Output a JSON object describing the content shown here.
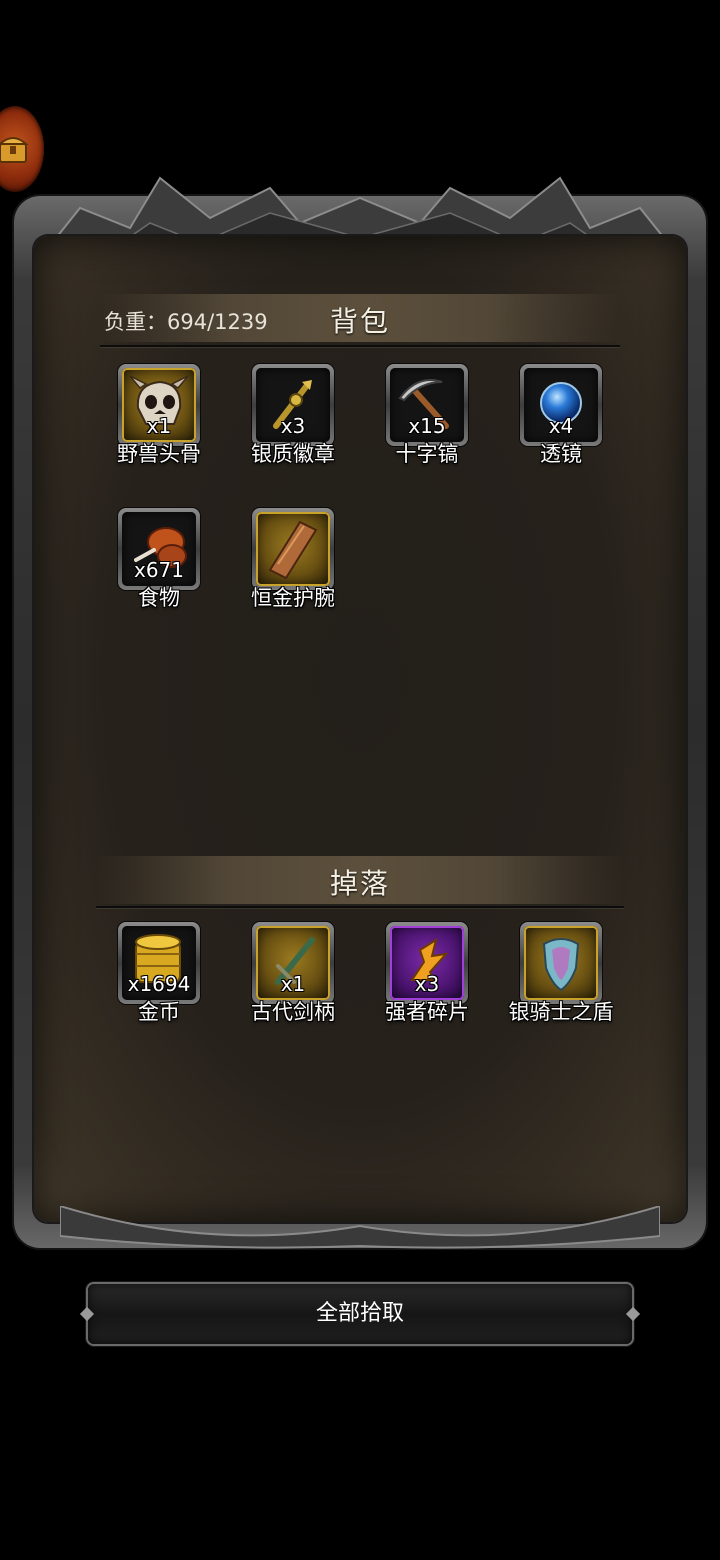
{
  "colors": {
    "gold_frame": "#c9a22a",
    "purple_frame": "#a040d8",
    "panel": "#26211b"
  },
  "inventory": {
    "weight_text": "负重：694/1239",
    "title": "背包",
    "items": [
      {
        "name": "野兽头骨",
        "count": "x1",
        "rarity": "gold",
        "icon": "beast-skull-icon"
      },
      {
        "name": "银质徽章",
        "count": "x3",
        "rarity": "normal",
        "icon": "silver-badge-icon"
      },
      {
        "name": "十字镐",
        "count": "x15",
        "rarity": "normal",
        "icon": "pickaxe-icon"
      },
      {
        "name": "透镜",
        "count": "x4",
        "rarity": "normal",
        "icon": "lens-icon"
      },
      {
        "name": "食物",
        "count": "x671",
        "rarity": "normal",
        "icon": "food-icon"
      },
      {
        "name": "恒金护腕",
        "count": "",
        "rarity": "gold",
        "icon": "bracer-icon"
      }
    ]
  },
  "drops": {
    "title": "掉落",
    "items": [
      {
        "name": "金币",
        "count": "x1694",
        "rarity": "normal",
        "icon": "gold-coins-icon"
      },
      {
        "name": "古代剑柄",
        "count": "x1",
        "rarity": "gold",
        "icon": "sword-hilt-icon"
      },
      {
        "name": "强者碎片",
        "count": "x3",
        "rarity": "purple",
        "icon": "shard-icon"
      },
      {
        "name": "银骑士之盾",
        "count": "",
        "rarity": "gold",
        "icon": "shield-icon"
      }
    ]
  },
  "pickup_all_label": "全部拾取"
}
